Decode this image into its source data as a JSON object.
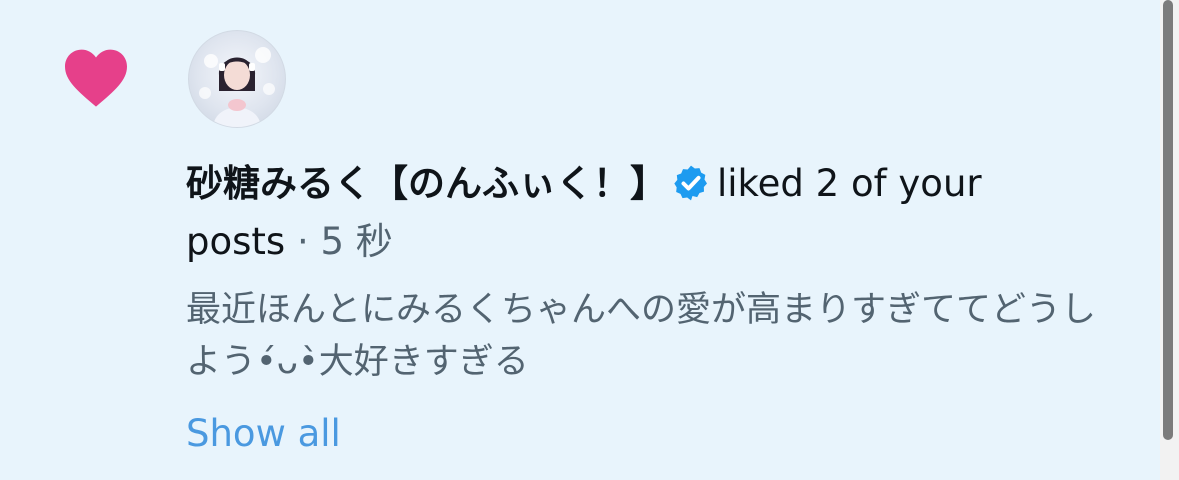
{
  "notification": {
    "heart_color": "#e0245e",
    "icon": "heart-icon",
    "user_name": "砂糖みるく【のんふぃく！】",
    "verified_icon": "verified-badge-icon",
    "verified_color": "#1d9bf0",
    "action": "liked 2 of your",
    "action_cont": "posts",
    "separator": "·",
    "time": "5 秒",
    "post_text": "最近ほんとにみるくちゃんへの愛が高まりすぎててどうしよう•́ᴗ•̀大好きすぎる",
    "show_all": "Show all"
  }
}
